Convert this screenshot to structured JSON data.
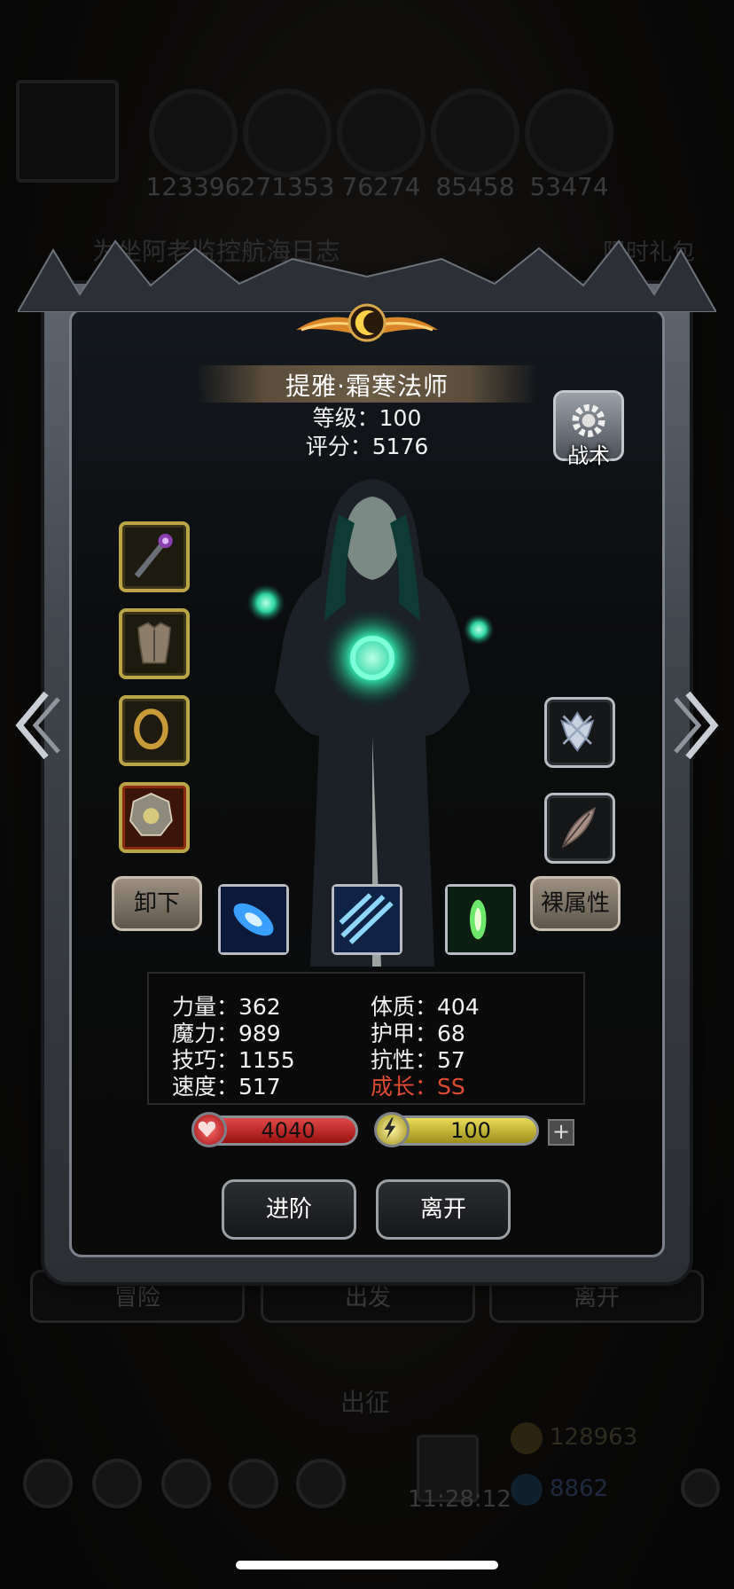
{
  "background": {
    "resources": [
      "123396",
      "271353",
      "76274",
      "85458",
      "53474"
    ],
    "banner_text": "为坐阿老监控航海日志",
    "promo_tag": "限时礼包",
    "bottom_buttons": [
      "冒险",
      "出发",
      "离开"
    ],
    "expedition_label": "出征",
    "clock": "11:28:12",
    "currency_gold": "128963",
    "currency_gem": "8862"
  },
  "hero": {
    "name": "提雅·霜寒法师",
    "level_line": "等级：100",
    "score_line": "评分：5176",
    "tactics_label": "战术"
  },
  "equipment": {
    "left_slots": [
      "staff-icon",
      "armor-icon",
      "ring-icon",
      "amulet-icon"
    ],
    "right_slots": [
      "crest-icon",
      "feather-icon"
    ]
  },
  "skills": [
    "ice-shard-icon",
    "frost-storm-icon",
    "nature-crystal-icon"
  ],
  "buttons": {
    "unequip": "卸下",
    "base_attributes": "裸属性",
    "advance": "进阶",
    "leave": "离开"
  },
  "stats": {
    "strength": "力量：362",
    "magic": "魔力：989",
    "skill": "技巧：1155",
    "speed": "速度：517",
    "constitution": "体质：404",
    "armor": "护甲：68",
    "resistance": "抗性：57",
    "growth": "成长：SS"
  },
  "bars": {
    "hp": "4040",
    "energy": "100",
    "energy_plus": "+"
  },
  "colors": {
    "growth_text": "#e04b33",
    "hp_bar": "#c42424",
    "energy_bar": "#d4c63a",
    "frame_silver": "#7a818a"
  }
}
